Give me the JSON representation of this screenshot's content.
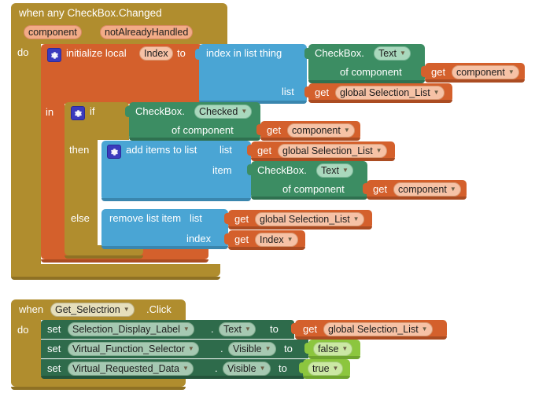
{
  "app": {
    "name": "MIT App Inventor Blocks Editor",
    "canvas_background": "#ffffff"
  },
  "colors": {
    "event_block": "#b08d2e",
    "control_block": "#b08d2e",
    "variable_block": "#d4602c",
    "list_block": "#4aa5d4",
    "component_getter_block": "#3c8d63",
    "component_setter_block": "#2e6b4b",
    "logic_block": "#8cc63e",
    "parameter_pill": "#f2ab87"
  },
  "blocks": {
    "event_checkbox_changed": {
      "header": "when any CheckBox.Changed",
      "params": [
        "component",
        "notAlreadyHandled"
      ],
      "do_label": "do",
      "init_local": {
        "statement": "initialize local",
        "var_name": "Index",
        "to_label": "to",
        "in_label": "in",
        "value": {
          "name": "index in list",
          "thing_label": "thing",
          "list_label": "list",
          "thing_value": {
            "component": "CheckBox.",
            "property": "Text",
            "of_component_label": "of component",
            "getter": {
              "get_label": "get",
              "value": "component"
            }
          },
          "list_value": {
            "get_label": "get",
            "value": "global Selection_List"
          }
        },
        "body": {
          "if_label": "if",
          "then_label": "then",
          "else_label": "else",
          "condition": {
            "component": "CheckBox.",
            "property": "Checked",
            "of_component_label": "of component",
            "getter": {
              "get_label": "get",
              "value": "component"
            }
          },
          "then_statement": {
            "name": "add items to list",
            "list_label": "list",
            "item_label": "item",
            "list_value": {
              "get_label": "get",
              "value": "global Selection_List"
            },
            "item_value": {
              "component": "CheckBox.",
              "property": "Text",
              "of_component_label": "of component",
              "getter": {
                "get_label": "get",
                "value": "component"
              }
            }
          },
          "else_statement": {
            "name": "remove list item",
            "list_label": "list",
            "index_label": "index",
            "list_value": {
              "get_label": "get",
              "value": "global Selection_List"
            },
            "index_value": {
              "get_label": "get",
              "value": "Index"
            }
          }
        }
      }
    },
    "event_get_selectrion_click": {
      "when_label": "when",
      "component": "Get_Selectrion",
      "event": ".Click",
      "do_label": "do",
      "statements": [
        {
          "set_label": "set",
          "component": "Selection_Display_Label",
          "dot": ".",
          "property": "Text",
          "to_label": "to",
          "value_kind": "getter",
          "value": {
            "get_label": "get",
            "value": "global Selection_List"
          }
        },
        {
          "set_label": "set",
          "component": "Virtual_Function_Selector",
          "dot": ".",
          "property": "Visible",
          "to_label": "to",
          "value_kind": "logic",
          "value": {
            "value": "false"
          }
        },
        {
          "set_label": "set",
          "component": "Virtual_Requested_Data",
          "dot": ".",
          "property": "Visible",
          "to_label": "to",
          "value_kind": "logic",
          "value": {
            "value": "true"
          }
        }
      ]
    }
  },
  "icons": {
    "mutator": "gear-icon",
    "dropdown": "chevron-down-icon"
  }
}
